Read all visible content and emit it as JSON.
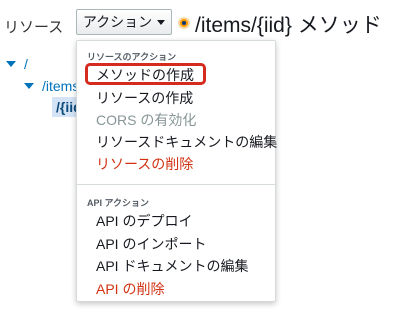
{
  "sidebar": {
    "resources_label": "リソース",
    "actions_button_label": "アクション",
    "tree": [
      {
        "path": "/",
        "expanded": true
      },
      {
        "path": "/items",
        "expanded": true
      },
      {
        "path": "/{iid}",
        "selected": true
      }
    ]
  },
  "header": {
    "title": "/items/{iid} メソッド"
  },
  "actions_menu": {
    "resource_section": {
      "header": "リソースのアクション",
      "items": [
        {
          "label": "メソッドの作成",
          "highlighted": true
        },
        {
          "label": "リソースの作成"
        },
        {
          "label": "CORS の有効化",
          "disabled": true
        },
        {
          "label": "リソースドキュメントの編集"
        },
        {
          "label": "リソースの削除",
          "danger": true
        }
      ]
    },
    "api_section": {
      "header": "API アクション",
      "items": [
        {
          "label": "API のデプロイ"
        },
        {
          "label": "API のインポート"
        },
        {
          "label": "API ドキュメントの編集"
        },
        {
          "label": "API の削除",
          "danger": true
        }
      ]
    }
  },
  "colors": {
    "link": "#0073bb",
    "danger": "#d13212",
    "disabled": "#879596",
    "highlight_outline": "#d52b1e",
    "title_dot": "#ff9900"
  },
  "icons": {
    "tree_toggle": "caret-down-icon",
    "actions_caret": "caret-down-icon",
    "title_status": "status-dot-icon"
  }
}
